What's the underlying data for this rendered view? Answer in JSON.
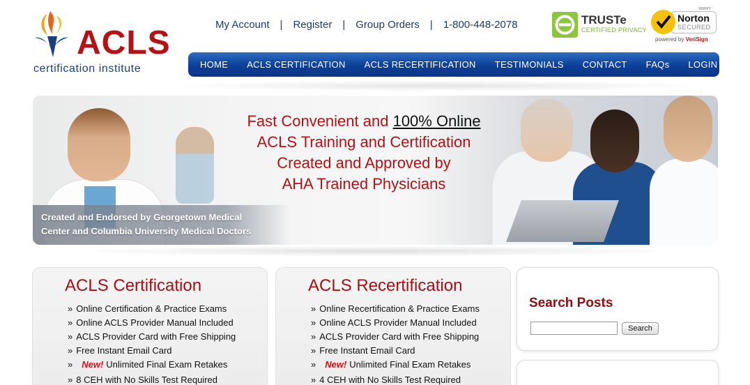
{
  "brand": {
    "name": "ACLS",
    "subtitle": "certification institute",
    "accent": "#b31217",
    "navy": "#1d3a72"
  },
  "toplinks": {
    "my_account": "My Account",
    "register": "Register",
    "group_orders": "Group Orders",
    "phone": "1-800-448-2078",
    "separator": "|"
  },
  "badges": {
    "truste_name": "TRUSTe",
    "truste_sub": "CERTIFIED PRIVACY",
    "norton_verify": "VERIFY",
    "norton_name": "Norton",
    "norton_sub": "SECURED",
    "norton_powered": "powered by",
    "norton_powered_brand": "VeriSign"
  },
  "nav": {
    "items": [
      "HOME",
      "ACLS CERTIFICATION",
      "ACLS RECERTIFICATION",
      "TESTIMONIALS",
      "CONTACT",
      "FAQs",
      "LOGIN"
    ],
    "color": "#0d3f97"
  },
  "banner": {
    "line1_a": "Fast Convenient and ",
    "line1_b": "100% Online",
    "line2": "ACLS Training and Certification",
    "line3": "Created and Approved by",
    "line4": "AHA Trained Physicians",
    "endorsed_1": "Created and Endorsed by Georgetown Medical",
    "endorsed_2": "Center and Columbia University Medical Doctors"
  },
  "certification": {
    "title": "ACLS Certification",
    "items": [
      {
        "text": "Online Certification & Practice Exams",
        "new": ""
      },
      {
        "text": "Online ACLS Provider Manual Included",
        "new": ""
      },
      {
        "text": "ACLS Provider Card with Free Shipping",
        "new": ""
      },
      {
        "text": "Free Instant Email Card",
        "new": ""
      },
      {
        "text": "Unlimited Final Exam Retakes",
        "new": "New!"
      },
      {
        "text": "8 CEH with No Skills Test Required",
        "new": ""
      }
    ]
  },
  "recertification": {
    "title": "ACLS Recertification",
    "items": [
      {
        "text": "Online Recertification & Practice Exams",
        "new": ""
      },
      {
        "text": "Online ACLS Provider Manual Included",
        "new": ""
      },
      {
        "text": "ACLS Provider Card with Free Shipping",
        "new": ""
      },
      {
        "text": "Free Instant Email Card",
        "new": ""
      },
      {
        "text": "Unlimited Final Exam Retakes",
        "new": "New!"
      },
      {
        "text": "4 CEH with No Skills Test Required",
        "new": ""
      }
    ]
  },
  "bullet": "»",
  "search": {
    "title": "Search Posts",
    "value": "",
    "button": "Search"
  }
}
